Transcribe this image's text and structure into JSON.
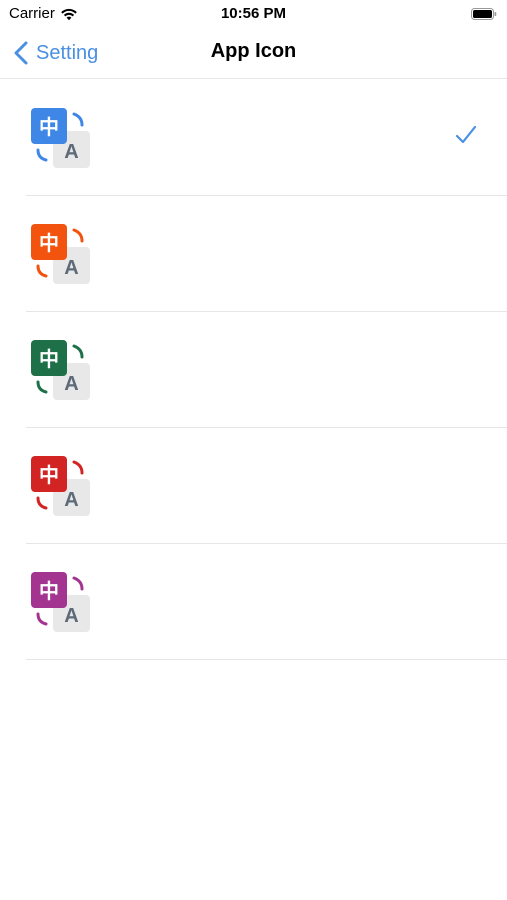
{
  "status_bar": {
    "carrier": "Carrier",
    "time": "10:56 PM",
    "icons": [
      "wifi-icon",
      "battery-icon"
    ]
  },
  "nav": {
    "back_label": "Setting",
    "title": "App Icon",
    "accent_color": "#4a90e2"
  },
  "app_icons": [
    {
      "id": "blue",
      "color": "#3f87e6",
      "glyph": "中",
      "letter": "A",
      "selected": true
    },
    {
      "id": "orange",
      "color": "#f2530f",
      "glyph": "中",
      "letter": "A",
      "selected": false
    },
    {
      "id": "green",
      "color": "#1d7047",
      "glyph": "中",
      "letter": "A",
      "selected": false
    },
    {
      "id": "red",
      "color": "#d32424",
      "glyph": "中",
      "letter": "A",
      "selected": false
    },
    {
      "id": "purple",
      "color": "#a3348f",
      "glyph": "中",
      "letter": "A",
      "selected": false
    }
  ],
  "checkmark_icon": "checkmark-icon"
}
